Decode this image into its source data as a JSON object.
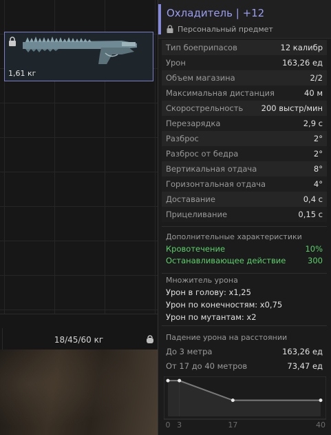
{
  "inventory": {
    "weapon_weight": "1,61 кг",
    "total_weight": "18/45/60 кг"
  },
  "tooltip": {
    "title": "Охладитель | +12",
    "subtitle": "Персональный предмет",
    "accent_color": "#8489dc",
    "stats": [
      {
        "name": "Тип боеприпасов",
        "value": "12 калибр"
      },
      {
        "name": "Урон",
        "value": "163,26 ед"
      },
      {
        "name": "Объем магазина",
        "value": "2/2"
      },
      {
        "name": "Максимальная дистанция",
        "value": "40 м"
      },
      {
        "name": "Скорострельность",
        "value": "200 выстр/мин"
      },
      {
        "name": "Перезарядка",
        "value": "2,9 с"
      },
      {
        "name": "Разброс",
        "value": "2°"
      },
      {
        "name": "Разброс от бедра",
        "value": "2°"
      },
      {
        "name": "Вертикальная отдача",
        "value": "8°"
      },
      {
        "name": "Горизонтальная отдача",
        "value": "4°"
      },
      {
        "name": "Доставание",
        "value": "0,4 с"
      },
      {
        "name": "Прицеливание",
        "value": "0,15 с"
      }
    ],
    "extra": {
      "title": "Дополнительные характеристики",
      "items": [
        {
          "name": "Кровотечение",
          "value": "10%"
        },
        {
          "name": "Останавливающее действие",
          "value": "300"
        }
      ],
      "color": "#5bd06a"
    },
    "multiplier": {
      "title": "Множитель урона",
      "lines": [
        "Урон в голову: x1,25",
        "Урон по конечностям: x0,75",
        "Урон по мутантам: x2"
      ]
    },
    "falloff": {
      "title": "Падение урона на расстоянии",
      "rows": [
        {
          "name": "До 3 метра",
          "value": "163,26 ед"
        },
        {
          "name": "От 17 до 40 метров",
          "value": "73,47 ед"
        }
      ]
    }
  },
  "chart_data": {
    "type": "line",
    "x": [
      0,
      3,
      17,
      40
    ],
    "values": [
      163.26,
      163.26,
      73.47,
      73.47
    ],
    "x_ticks": [
      "0",
      "3",
      "17",
      "40"
    ],
    "xlim": [
      0,
      40
    ],
    "ylim": [
      0,
      170
    ]
  }
}
